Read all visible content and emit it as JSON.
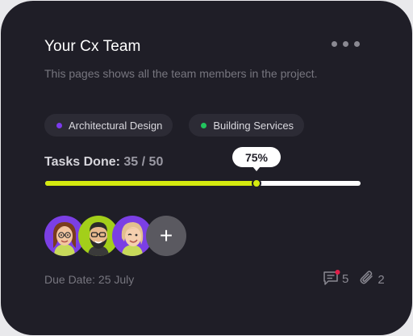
{
  "card": {
    "title": "Your Cx Team",
    "subtitle": "This pages shows all the team members in the project."
  },
  "tags": [
    {
      "label": "Architectural Design",
      "color": "#7c3aed"
    },
    {
      "label": "Building Services",
      "color": "#22c55e"
    }
  ],
  "tasks": {
    "label": "Tasks Done:",
    "value": "35 / 50",
    "percent_label": "75%",
    "progress": 0.67
  },
  "avatars": [
    {
      "name": "female-avatar",
      "bg": "#7b3fe4"
    },
    {
      "name": "male-avatar",
      "bg": "#a3cf1a"
    },
    {
      "name": "winking-avatar",
      "bg": "#7b3fe4"
    }
  ],
  "add_member_symbol": "+",
  "due_date": "Due Date: 25 July",
  "comments": {
    "count": "5",
    "icon": "comment-icon",
    "badge_color": "#e11d48"
  },
  "attachments": {
    "count": "2",
    "icon": "paperclip-icon"
  },
  "colors": {
    "accent": "#d4ea0f",
    "card_bg": "#1f1e27"
  }
}
